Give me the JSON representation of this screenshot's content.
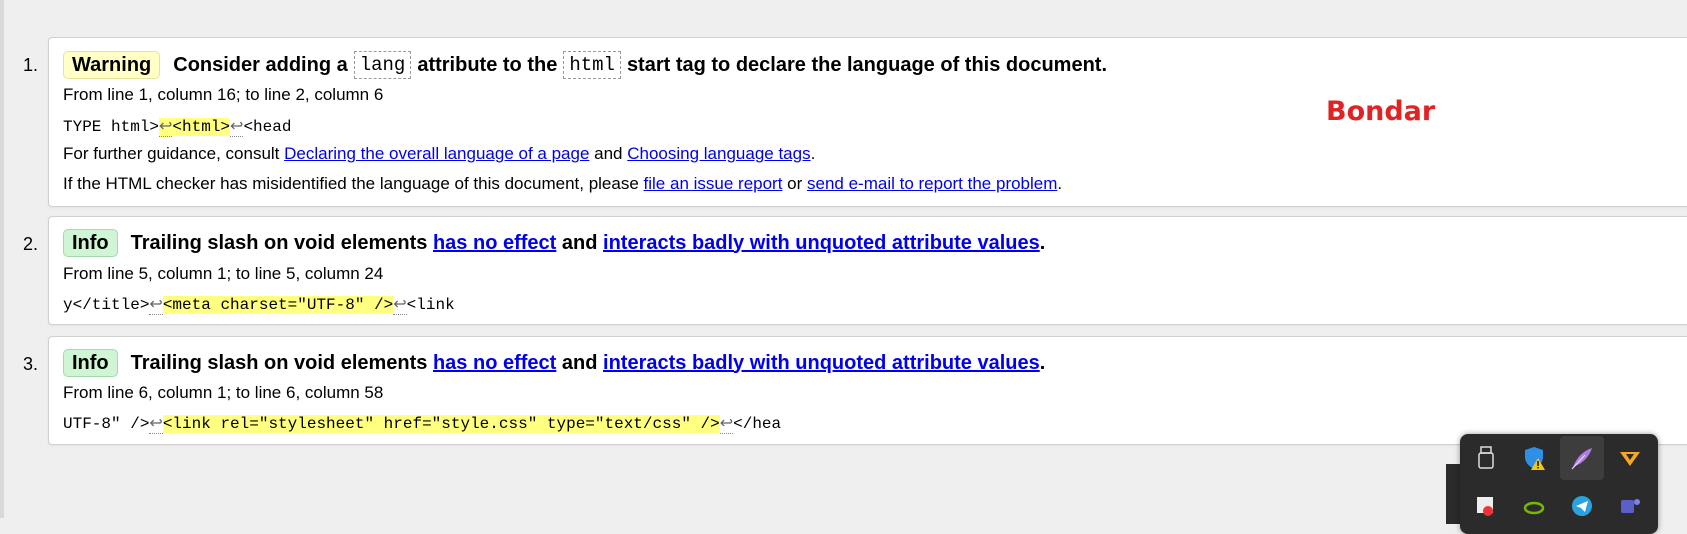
{
  "messages": [
    {
      "number": "1.",
      "type": "Warning",
      "pre": "Consider adding a",
      "code1": "lang",
      "mid": "attribute to the",
      "code2": "html",
      "post": "start tag to declare the language of this document.",
      "location": "From line 1, column 16; to line 2, column 6",
      "extract_before": "TYPE html>",
      "extract_ret1": "↩",
      "extract_hl": "<html>",
      "extract_ret2": "↩",
      "extract_after": "<head",
      "guidance_text": "For further guidance, consult ",
      "guidance_link1": "Declaring the overall language of a page",
      "guidance_and": " and ",
      "guidance_link2": "Choosing language tags",
      "guidance_end": ".",
      "issue_text": "If the HTML checker has misidentified the language of this document, please ",
      "issue_link1": "file an issue report",
      "issue_or": " or ",
      "issue_link2": "send e-mail to report the problem",
      "issue_end": "."
    },
    {
      "number": "2.",
      "type": "Info",
      "pre": "Trailing slash on void elements",
      "link1": "has no effect",
      "and": "and",
      "link2": "interacts badly with unquoted attribute values",
      "end": ".",
      "location": "From line 5, column 1; to line 5, column 24",
      "extract_before": "y</title>",
      "extract_ret1": "↩",
      "extract_hl": "<meta charset=\"UTF-8\" />",
      "extract_ret2": "↩",
      "extract_after": "<link"
    },
    {
      "number": "3.",
      "type": "Info",
      "pre": "Trailing slash on void elements",
      "link1": "has no effect",
      "and": "and",
      "link2": "interacts badly with unquoted attribute values",
      "end": ".",
      "location": "From line 6, column 1; to line 6, column 58",
      "extract_before": "UTF-8\" />",
      "extract_ret1": "↩",
      "extract_hl": "<link rel=\"stylesheet\" href=\"style.css\" type=\"text/css\" />",
      "extract_ret2": "↩",
      "extract_after": "</hea"
    }
  ],
  "signature": "Bondar",
  "tray_icons": [
    "usb-drive-icon",
    "windows-security-warning-icon",
    "feather-app-icon",
    "vpn-app-icon",
    "snipping-tool-icon",
    "nvidia-icon",
    "telegram-icon",
    "teams-icon"
  ],
  "colors": {
    "warning_badge": "#ffffc6",
    "info_badge": "#cff5d4",
    "highlight": "#ffff80",
    "link": "#0000ee",
    "signature": "#e02424"
  }
}
